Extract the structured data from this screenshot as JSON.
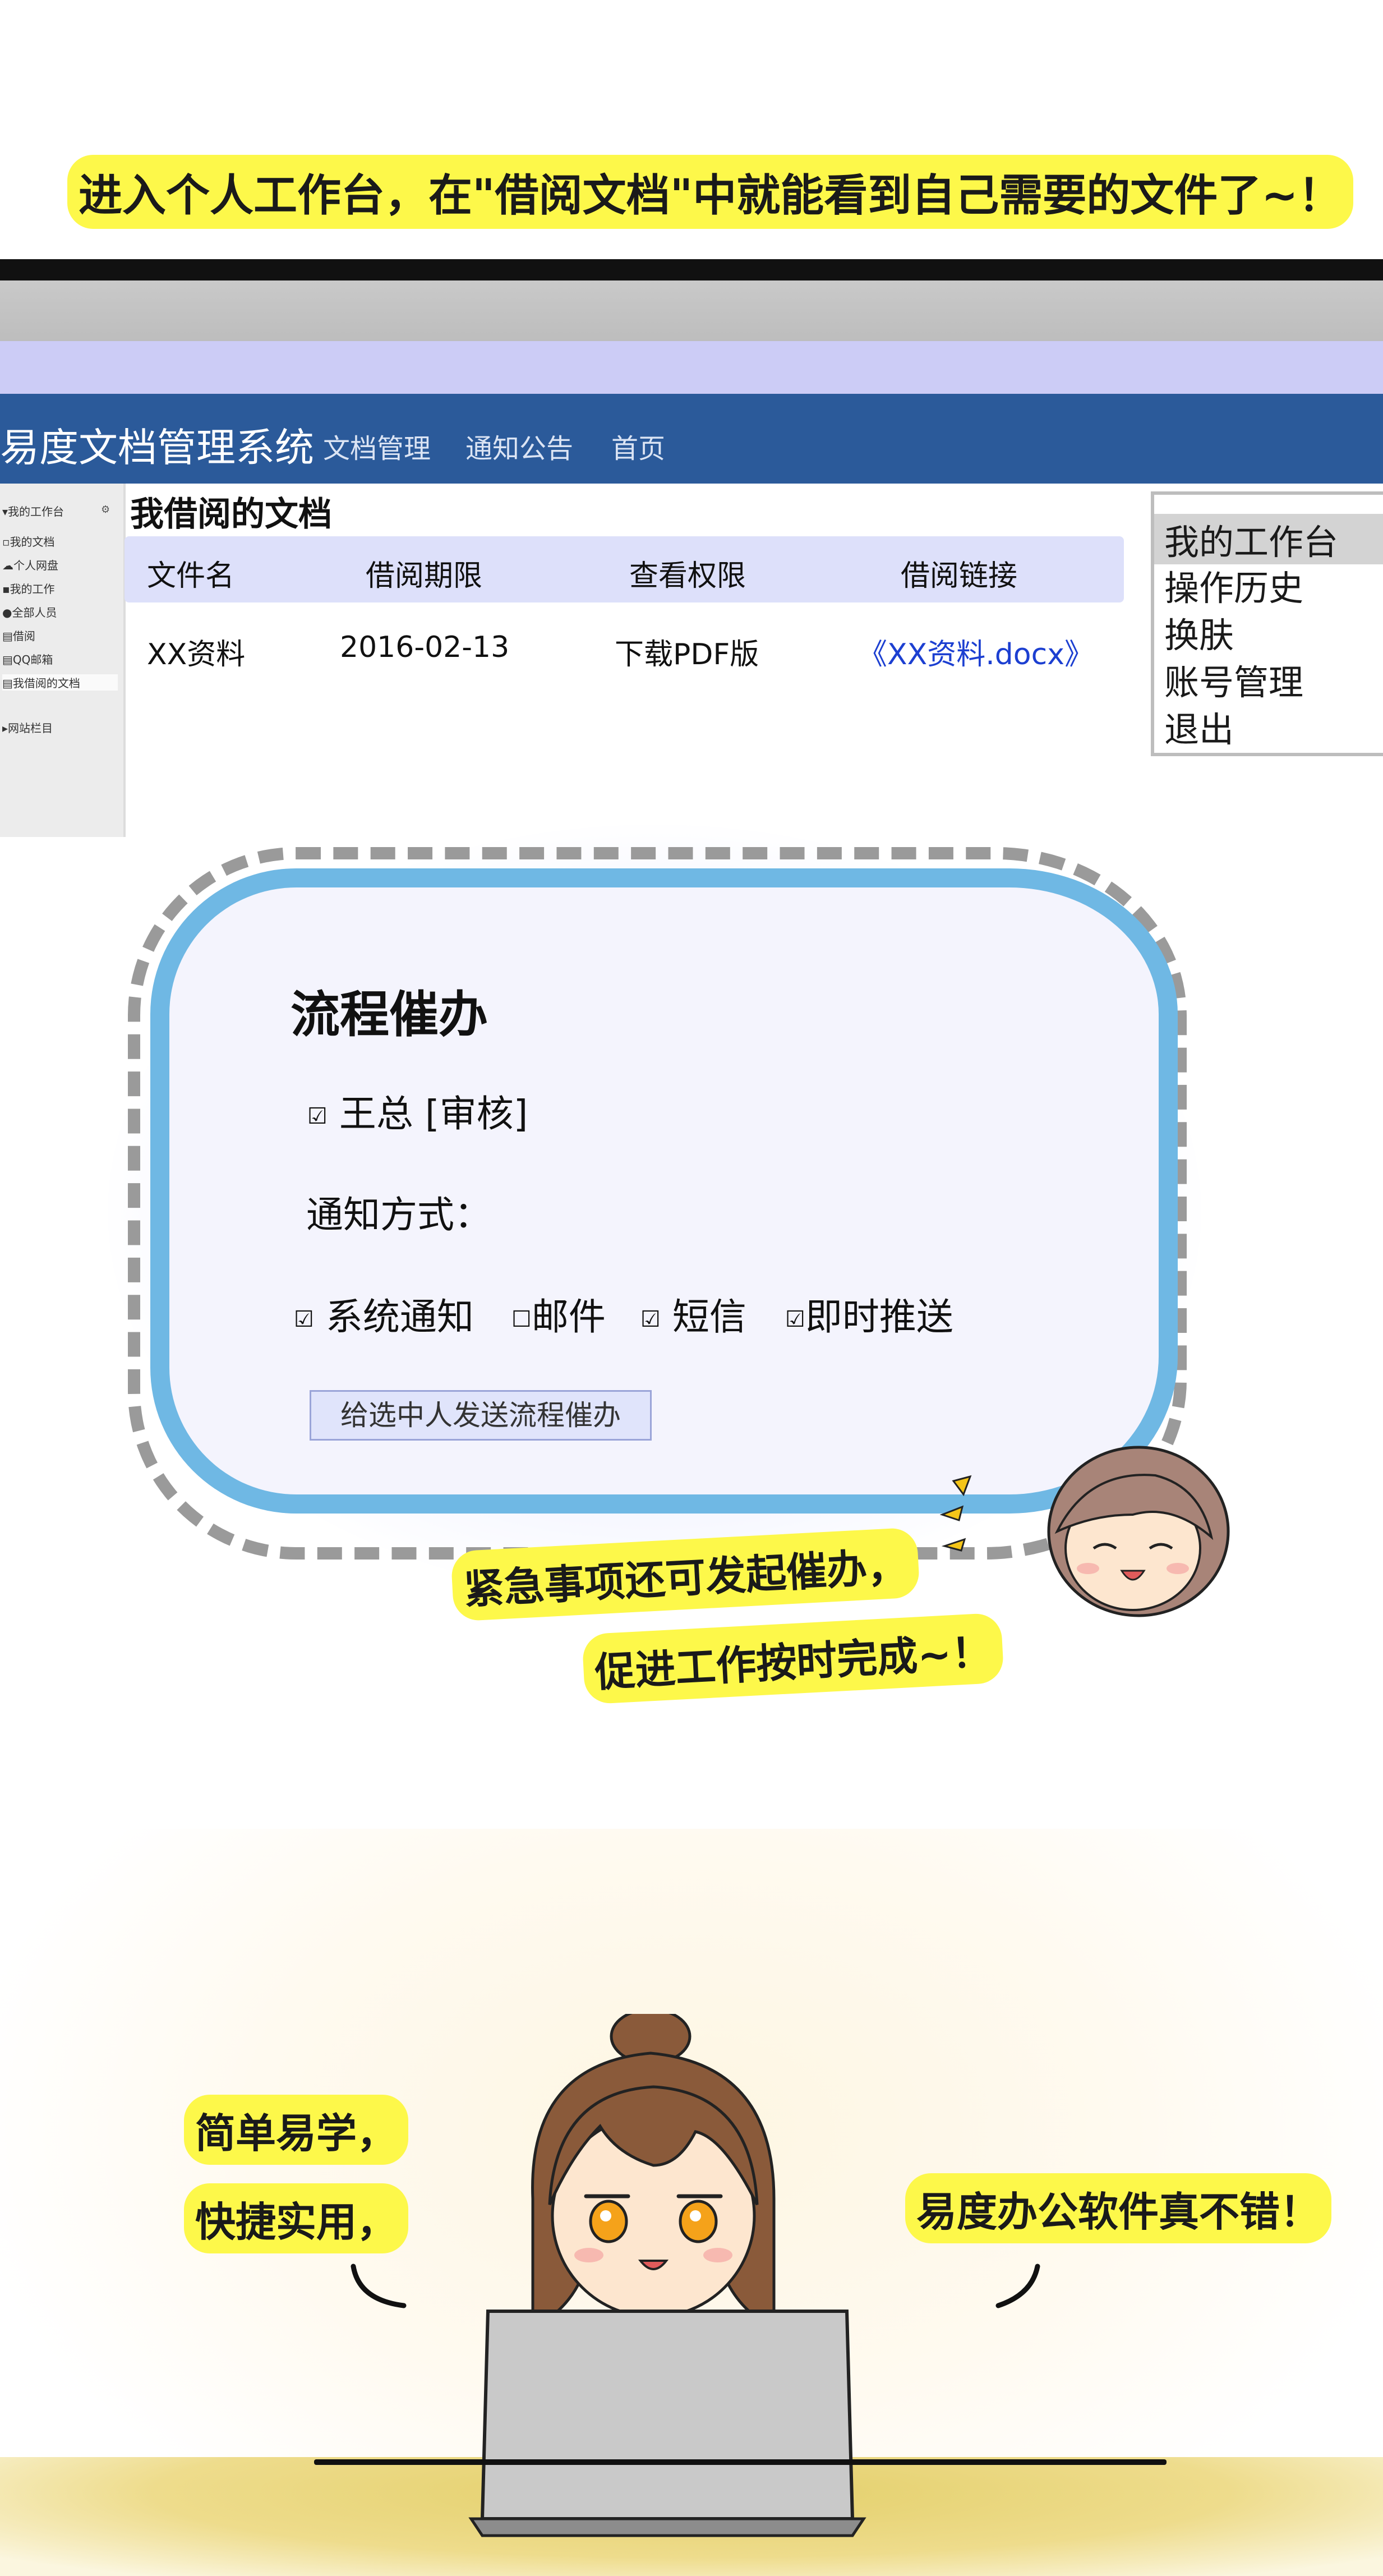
{
  "captions": {
    "top": "进入个人工作台，在\"借阅文档\"中就能看到自己需要的文件了~！",
    "urgent_line1": "紧急事项还可发起催办，",
    "urgent_line2": "促进工作按时完成~！",
    "left_line1": "简单易学，",
    "left_line2": "快捷实用，",
    "right_line1": "易度办公软件真不错！"
  },
  "app": {
    "brand": "易度文档管理系统",
    "nav": [
      "文档管理",
      "通知公告",
      "首页"
    ]
  },
  "sidebar": {
    "items": [
      {
        "icon": "caret-down-icon",
        "label": "▾我的工作台"
      },
      {
        "icon": "file-icon",
        "label": "我的文档"
      },
      {
        "icon": "cloud-icon",
        "label": "个人网盘"
      },
      {
        "icon": "briefcase-icon",
        "label": "我的工作"
      },
      {
        "icon": "users-icon",
        "label": "全部人员"
      },
      {
        "icon": "book-icon",
        "label": "借阅"
      },
      {
        "icon": "mail-icon",
        "label": "QQ邮箱"
      },
      {
        "icon": "document-icon",
        "label": "我借阅的文档"
      },
      {
        "icon": "caret-right-icon",
        "label": "▸网站栏目"
      }
    ],
    "active_index": 7
  },
  "documents": {
    "title": "我借阅的文档",
    "columns": [
      "文件名",
      "借阅期限",
      "查看权限",
      "借阅链接"
    ],
    "rows": [
      {
        "name": "XX资料",
        "deadline": "2016-02-13",
        "permission": "下载PDF版",
        "link": "《XX资料.docx》"
      }
    ]
  },
  "menu": {
    "items": [
      "我的工作台",
      "操作历史",
      "换肤",
      "账号管理",
      "退出"
    ],
    "active_index": 0
  },
  "reminder": {
    "title": "流程催办",
    "approver": "王总 [审核]",
    "notify_label": "通知方式：",
    "options": [
      {
        "label": "系统通知",
        "checked": true
      },
      {
        "label": "邮件",
        "checked": false
      },
      {
        "label": "短信",
        "checked": true
      },
      {
        "label": "即时推送",
        "checked": true
      }
    ],
    "button": "给选中人发送流程催办"
  },
  "colors": {
    "navbar": "#2b5a9a",
    "header_row": "#dde0fa",
    "bubble_border": "#6fb8e4",
    "highlight": "#fdf84a",
    "link": "#1c3fd1"
  }
}
